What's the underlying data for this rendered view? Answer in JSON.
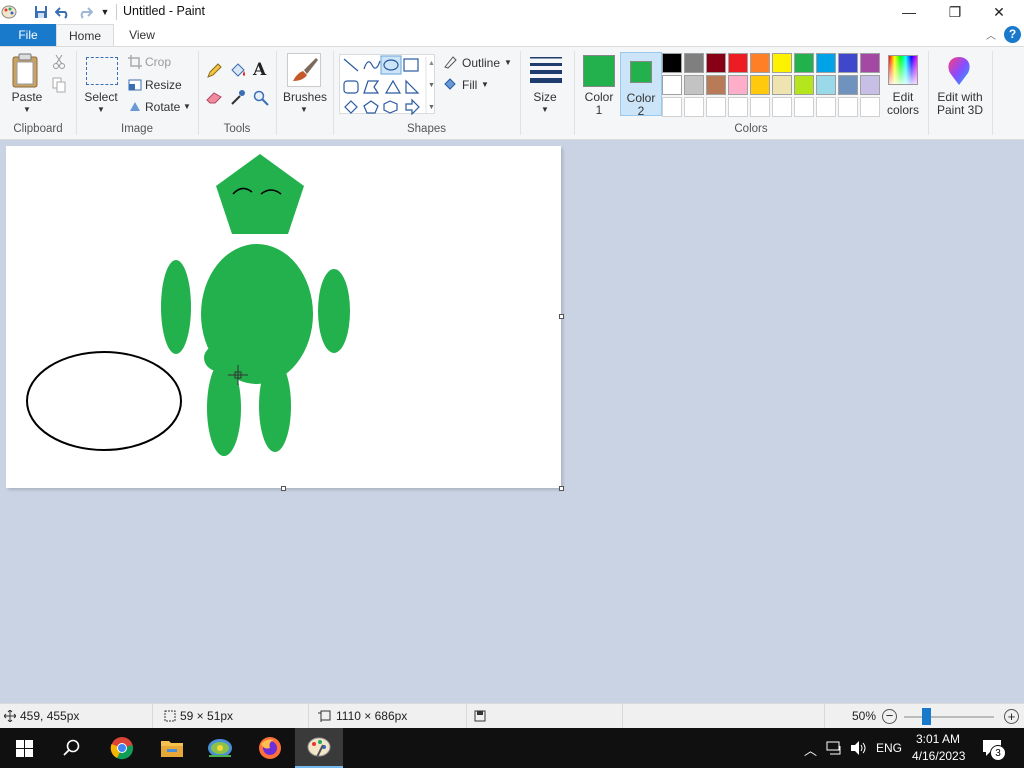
{
  "window": {
    "title": "Untitled - Paint",
    "minimize_glyph": "—",
    "restore_glyph": "❐",
    "close_glyph": "✕"
  },
  "tabs": {
    "file": "File",
    "home": "Home",
    "view": "View"
  },
  "ribbon": {
    "clipboard": {
      "paste": "Paste",
      "group": "Clipboard"
    },
    "image": {
      "select": "Select",
      "crop": "Crop",
      "resize": "Resize",
      "rotate": "Rotate",
      "group": "Image"
    },
    "tools": {
      "group": "Tools"
    },
    "brushes": {
      "label": "Brushes"
    },
    "shapes": {
      "outline": "Outline",
      "fill": "Fill",
      "group": "Shapes"
    },
    "size": {
      "label": "Size"
    },
    "colors": {
      "color1_line1": "Color",
      "color1_line2": "1",
      "color2_line1": "Color",
      "color2_line2": "2",
      "edit_line1": "Edit",
      "edit_line2": "colors",
      "paint3d_line1": "Edit with",
      "paint3d_line2": "Paint 3D",
      "group": "Colors",
      "color1_value": "#22b14c",
      "color2_value": "#22b14c",
      "palette_row1": [
        "#000000",
        "#7f7f7f",
        "#880015",
        "#ed1c24",
        "#ff7f27",
        "#fff200",
        "#22b14c",
        "#00a2e8",
        "#3f48cc",
        "#a349a4"
      ],
      "palette_row2": [
        "#ffffff",
        "#c3c3c3",
        "#b97a57",
        "#ffaec9",
        "#ffc90e",
        "#efe4b0",
        "#b5e61d",
        "#99d9ea",
        "#7092be",
        "#c8bfe7"
      ]
    }
  },
  "status": {
    "cursor_pos": "459, 455px",
    "selection_size": "59 × 51px",
    "image_size": "1110 × 686px",
    "zoom": "50%",
    "zoom_level": 0.5
  },
  "taskbar": {
    "lang": "ENG",
    "time": "3:01 AM",
    "date": "4/16/2023",
    "notifications": "3"
  },
  "drawing": {
    "fill": "#22b14c",
    "outline": "#000000"
  }
}
